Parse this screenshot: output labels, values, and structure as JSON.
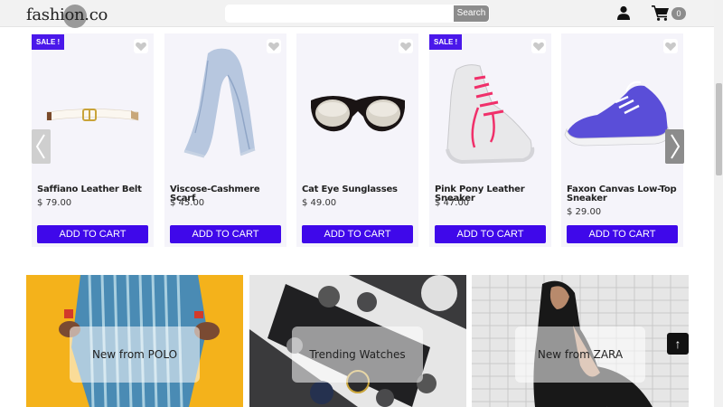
{
  "header": {
    "logo_text": "fashion.co",
    "search": {
      "placeholder": "",
      "button_label": "Search"
    },
    "cart_count": "0"
  },
  "products": [
    {
      "name": "Saffiano Leather Belt",
      "price": "$ 79.00",
      "sale_badge": "SALE !",
      "add_label": "ADD TO CART",
      "icon": "belt"
    },
    {
      "name": "Viscose-Cashmere Scarf",
      "price": "$ 45.00",
      "sale_badge": "",
      "add_label": "ADD TO CART",
      "icon": "scarf"
    },
    {
      "name": "Cat Eye Sunglasses",
      "price": "$ 49.00",
      "sale_badge": "",
      "add_label": "ADD TO CART",
      "icon": "sunglasses"
    },
    {
      "name": "Pink Pony Leather Sneaker",
      "price": "$ 47.00",
      "sale_badge": "SALE !",
      "add_label": "ADD TO CART",
      "icon": "sneaker-pink"
    },
    {
      "name": "Faxon Canvas Low-Top Sneaker",
      "price": "$ 29.00",
      "sale_badge": "",
      "add_label": "ADD TO CART",
      "icon": "sneaker-blue"
    }
  ],
  "banners": [
    {
      "label": "New from POLO"
    },
    {
      "label": "Trending Watches"
    },
    {
      "label": "New from ZARA"
    }
  ],
  "back_to_top": "↑",
  "colors": {
    "accent": "#3f08ea",
    "header_bg": "#f2f2f2",
    "card_bg": "#f5f4fa"
  }
}
